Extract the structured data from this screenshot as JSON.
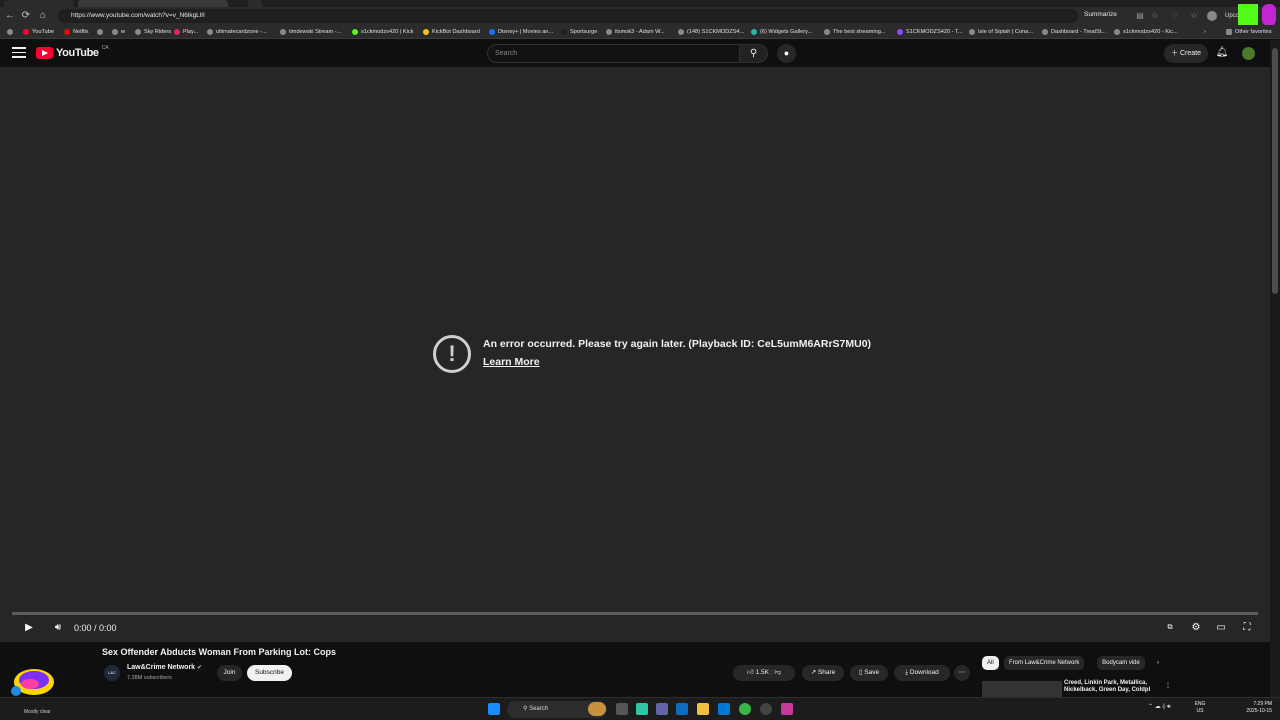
{
  "browser": {
    "url": "https://www.youtube.com/watch?v=v_N6lkgLlII",
    "summarize_label": "Summarize",
    "profile_label": "Upco",
    "bookmarks": [
      "YouTube",
      "Netflix",
      "w",
      "Sky Riders",
      "Play...",
      "ultimatecardzone -...",
      "timdewski Stream -...",
      "s1ckmodzs420 | Kick",
      "KickBot Dashboard",
      "Disney+ | Movies an...",
      "Sportsurge",
      "itsmok3 - Adam W...",
      "(148) S1CKMODZS4...",
      "(6) Widgets Gallery...",
      "The best streaming...",
      "S1CKMODZS420 - T...",
      "Isle of Siptah | Cona...",
      "Dashboard - TreatSt...",
      "s1ckmodzs420 - Kic..."
    ],
    "other_favorites": "Other favorites"
  },
  "youtube": {
    "logo_text": "YouTube",
    "country": "CA",
    "search_placeholder": "Search",
    "create_label": "Create"
  },
  "player": {
    "error_message": "An error occurred. Please try again later. (Playback ID: CeL5umM6ARrS7MU0)",
    "learn_more": "Learn More",
    "time": "0:00 / 0:00"
  },
  "video": {
    "title": "Sex Offender Abducts Woman From Parking Lot: Cops",
    "channel": "Law&Crime Network",
    "subscribers": "7.28M subscribers",
    "join_label": "Join",
    "subscribe_label": "Subscribe",
    "likes": "1.5K",
    "share_label": "Share",
    "save_label": "Save",
    "download_label": "Download"
  },
  "recommendations": {
    "chips": [
      "All",
      "From Law&Crime Network",
      "Bodycam vide"
    ],
    "first_title": "Creed, Linkin Park, Metallica, Nickelback, Green Day, Coldpl"
  },
  "taskbar": {
    "weather": "Mostly clear",
    "search_label": "Search",
    "lang_line1": "ENG",
    "lang_line2": "US",
    "time": "7:29 PM",
    "date": "2025-10-15"
  },
  "colors": {
    "yt_red": "#ff0033",
    "kick_green": "#53fc18",
    "background": "#0f0f0f",
    "player_bg": "#262626"
  }
}
